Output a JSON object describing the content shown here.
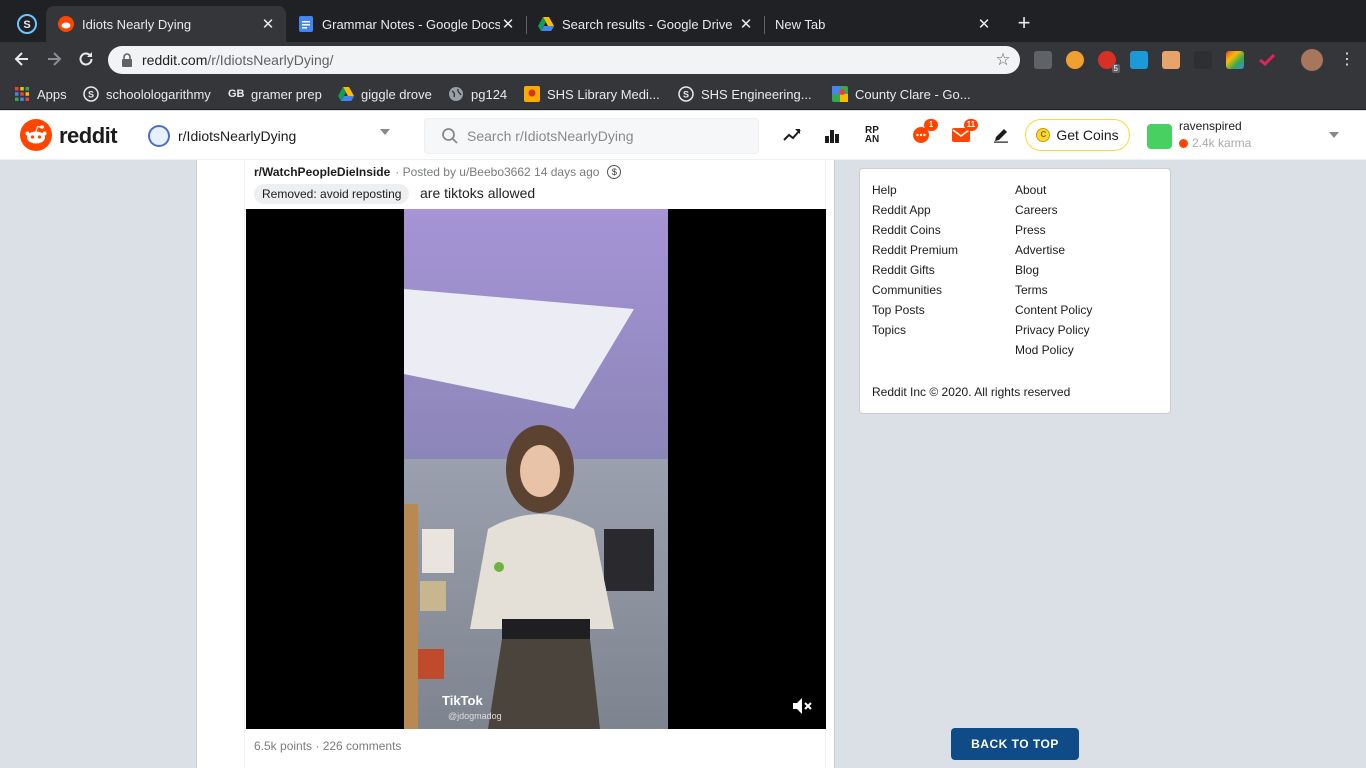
{
  "browser": {
    "tabs": [
      {
        "title": "Idiots Nearly Dying",
        "active": true
      },
      {
        "title": "Grammar Notes - Google Docs",
        "active": false
      },
      {
        "title": "Search results - Google Drive",
        "active": false
      },
      {
        "title": "New Tab",
        "active": false
      }
    ],
    "url_host": "reddit.com",
    "url_path": "/r/IdiotsNearlyDying/",
    "bookmarks": [
      "Apps",
      "schoolologarithmy",
      "gramer prep",
      "giggle drove",
      "pg124",
      "SHS Library Medi...",
      "SHS Engineering...",
      "County Clare - Go..."
    ],
    "extension_badge": "5"
  },
  "reddit": {
    "wordmark": "reddit",
    "subreddit": "r/IdiotsNearlyDying",
    "search_placeholder": "Search r/IdiotsNearlyDying",
    "chat_count": "1",
    "mail_count": "11",
    "get_coins": "Get Coins",
    "username": "ravenspired",
    "karma": "2.4k karma"
  },
  "post": {
    "subreddit": "r/WatchPeopleDieInside",
    "posted_by": "· Posted by u/Beebo3662 14 days ago",
    "flair": "Removed:  avoid reposting",
    "title": "are tiktoks allowed",
    "video_watermark": "TikTok",
    "video_user": "@jdogmadog",
    "stats": "6.5k points · 226 comments"
  },
  "sidebar": {
    "col1": [
      "Help",
      "Reddit App",
      "Reddit Coins",
      "Reddit Premium",
      "Reddit Gifts",
      "Communities",
      "Top Posts",
      "Topics"
    ],
    "col2": [
      "About",
      "Careers",
      "Press",
      "Advertise",
      "Blog",
      "Terms",
      "Content Policy",
      "Privacy Policy",
      "Mod Policy"
    ],
    "copyright": "Reddit Inc © 2020. All rights reserved",
    "back_to_top": "BACK TO TOP"
  },
  "colors": {
    "reddit_orange": "#ff4500",
    "back_to_top": "#0e4b87",
    "coin_border": "#ffd635"
  }
}
